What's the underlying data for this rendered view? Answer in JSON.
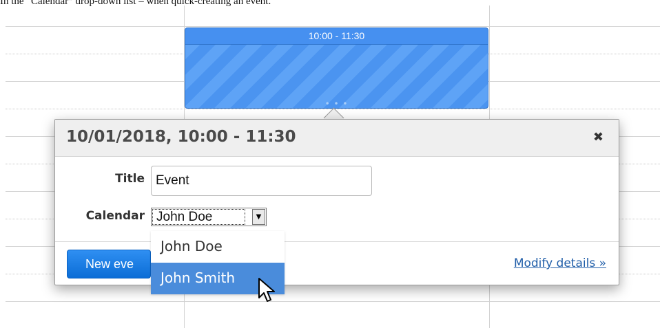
{
  "caption": "In the “Calendar” drop-down list – when quick-creating an event.",
  "event_block": {
    "time_range": "10:00 - 11:30",
    "color": "#4b94f0"
  },
  "popup": {
    "title": "10/01/2018, 10:00 - 11:30",
    "close_icon": "close-icon",
    "fields": {
      "title_label": "Title",
      "title_value": "Event",
      "calendar_label": "Calendar",
      "calendar_value": "John Doe"
    },
    "footer": {
      "new_event_button": "New eve",
      "modify_details_link": "Modify details »"
    }
  },
  "calendar_dropdown": {
    "options": [
      "John Doe",
      "John Smith"
    ],
    "highlighted": "John Smith",
    "highlight_color": "#4a8cdb"
  },
  "colors": {
    "accent": "#0b6dd6",
    "link": "#1f5da8"
  }
}
